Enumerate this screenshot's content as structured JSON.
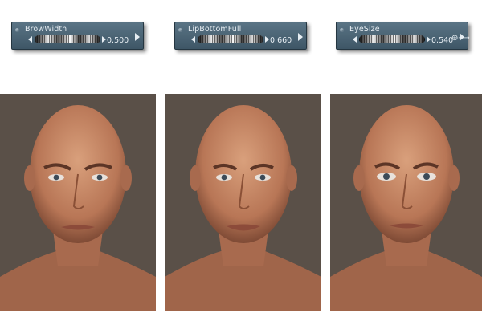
{
  "dials": [
    {
      "label": "BrowWidth",
      "value": "0.500"
    },
    {
      "label": "LipBottomFull",
      "value": "0.660"
    },
    {
      "label": "EyeSize",
      "value": "0.540"
    }
  ],
  "colors": {
    "dial_bg": "#4b6373",
    "viewport_bg": "#5a5048",
    "skin": "#c98b6a"
  }
}
